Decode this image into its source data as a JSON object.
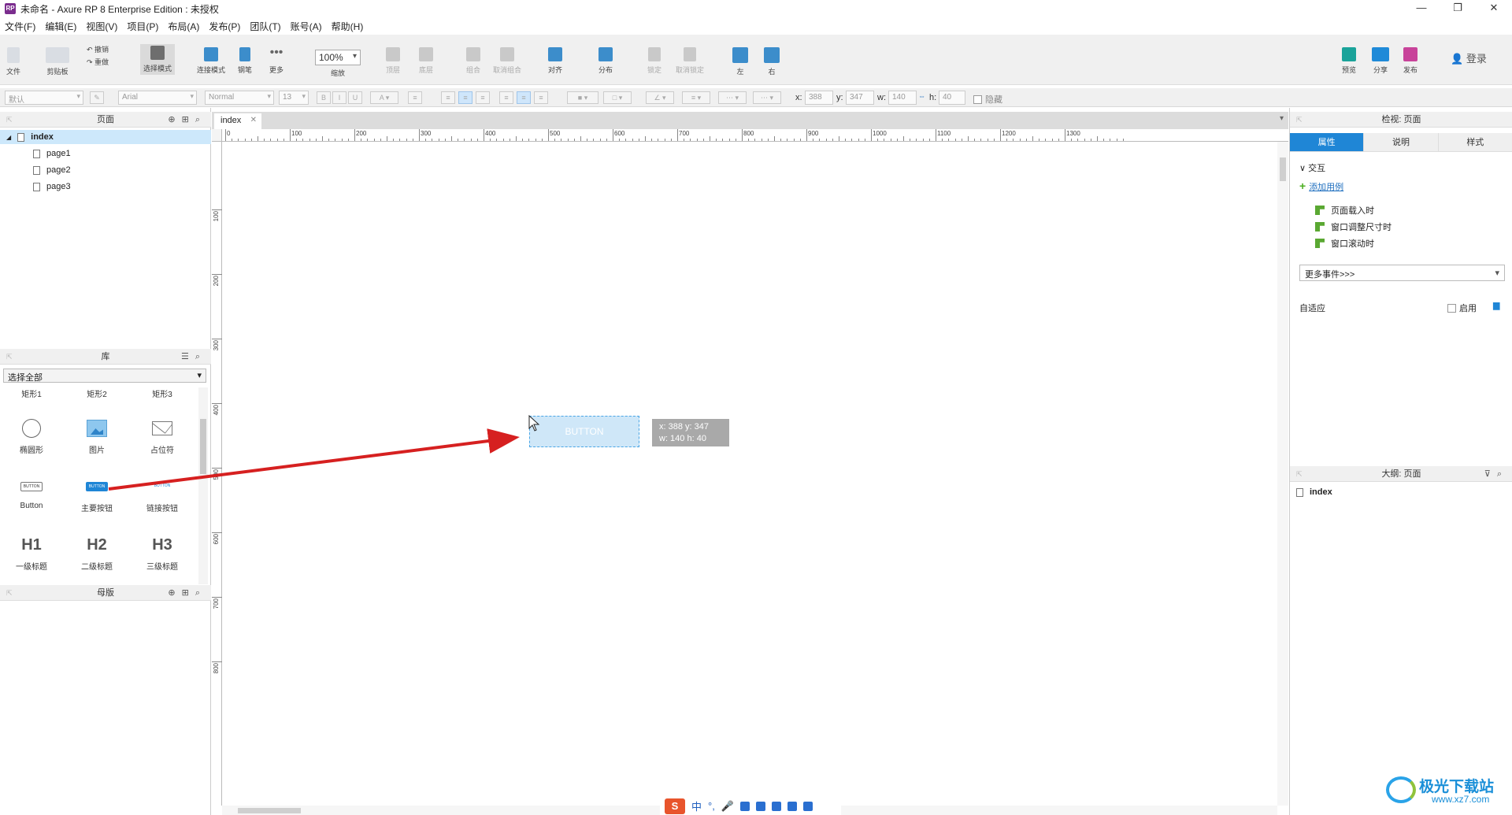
{
  "window": {
    "logo_text": "RP",
    "title": "未命名 - Axure RP 8 Enterprise Edition : 未授权",
    "controls": [
      "—",
      "❐",
      "✕"
    ]
  },
  "menu": [
    "文件(F)",
    "编辑(E)",
    "视图(V)",
    "项目(P)",
    "布局(A)",
    "发布(P)",
    "团队(T)",
    "账号(A)",
    "帮助(H)"
  ],
  "toolbar": {
    "file": "文件",
    "clipboard": "剪贴板",
    "undo": "撤销",
    "redo": "重做",
    "select_mode": "选择模式",
    "connect_mode": "连接模式",
    "pen": "钢笔",
    "more": "更多",
    "zoom_value": "100%",
    "zoom_label": "缩放",
    "top": "顶层",
    "bottom": "底层",
    "group": "组合",
    "ungroup": "取消组合",
    "align": "对齐",
    "distribute": "分布",
    "lock": "锁定",
    "unlock": "取消锁定",
    "left": "左",
    "right": "右",
    "preview": "预览",
    "share": "分享",
    "publish": "发布",
    "login": "登录"
  },
  "formatbar": {
    "style": "默认",
    "font": "Arial",
    "weight": "Normal",
    "size": "13",
    "x_label": "x:",
    "x_value": "388",
    "y_label": "y:",
    "y_value": "347",
    "w_label": "w:",
    "w_value": "140",
    "h_label": "h:",
    "h_value": "40",
    "hidden": "隐藏"
  },
  "pages_panel": {
    "title": "页面",
    "items": [
      "index",
      "page1",
      "page2",
      "page3"
    ]
  },
  "library_panel": {
    "title": "库",
    "selector": "选择全部",
    "widgets": [
      {
        "label": "矩形1",
        "icon": "rectangle-icon"
      },
      {
        "label": "矩形2",
        "icon": "rectangle-icon"
      },
      {
        "label": "矩形3",
        "icon": "rectangle-icon"
      },
      {
        "label": "椭圆形",
        "icon": "ellipse-icon"
      },
      {
        "label": "图片",
        "icon": "image-icon"
      },
      {
        "label": "占位符",
        "icon": "placeholder-icon"
      },
      {
        "label": "Button",
        "icon": "button-icon",
        "preview": "BUTTON"
      },
      {
        "label": "主要按钮",
        "icon": "primary-button-icon",
        "preview": "BUTTON"
      },
      {
        "label": "链接按钮",
        "icon": "link-button-icon",
        "preview": "BUTTON"
      },
      {
        "label": "一级标题",
        "icon": "h1-icon",
        "preview": "H1"
      },
      {
        "label": "二级标题",
        "icon": "h2-icon",
        "preview": "H2"
      },
      {
        "label": "三级标题",
        "icon": "h3-icon",
        "preview": "H3"
      }
    ]
  },
  "masters_panel": {
    "title": "母版"
  },
  "canvas": {
    "tab": "index",
    "ruler_top": [
      "0",
      "100",
      "200",
      "300",
      "400",
      "500",
      "600",
      "700",
      "800",
      "900",
      "1000",
      "1100",
      "1200",
      "1300"
    ],
    "ruler_left": [
      "100",
      "200",
      "300",
      "400",
      "500",
      "600",
      "700",
      "800"
    ],
    "dragged_widget": "BUTTON",
    "tooltip_line1": "x: 388   y: 347",
    "tooltip_line2": "w: 140   h: 40"
  },
  "inspector": {
    "title": "检视: 页面",
    "tabs": [
      "属性",
      "说明",
      "样式"
    ],
    "section": "交互",
    "add_case": "添加用例",
    "events": [
      "页面载入时",
      "窗口调整尺寸时",
      "窗口滚动时"
    ],
    "more_events": "更多事件>>>",
    "adaptive": "自适应",
    "enable": "启用"
  },
  "outline": {
    "title": "大纲: 页面",
    "item": "index"
  },
  "ime": {
    "logo": "S",
    "mode": "中"
  },
  "watermark": {
    "name": "极光下载站",
    "url": "www.xz7.com"
  },
  "colors": {
    "accent": "#1f86d6",
    "selection": "#cde8fb",
    "arrow": "#d62020"
  }
}
